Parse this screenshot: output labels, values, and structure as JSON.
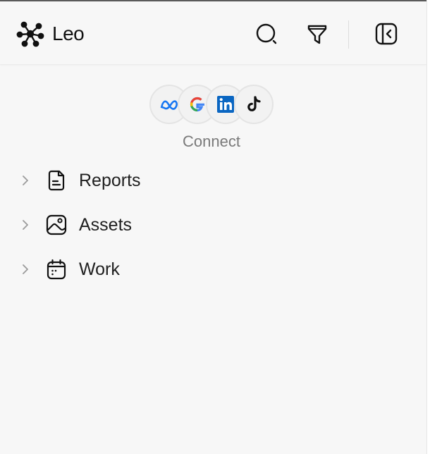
{
  "app": {
    "name": "Leo"
  },
  "header": {
    "icons": [
      "leo-logo",
      "search-icon",
      "filter-icon",
      "collapse-sidebar-icon"
    ]
  },
  "connect": {
    "label": "Connect",
    "providers": [
      "meta",
      "google",
      "linkedin",
      "tiktok"
    ]
  },
  "nav": {
    "items": [
      {
        "label": "Reports",
        "icon": "report-icon"
      },
      {
        "label": "Assets",
        "icon": "image-icon"
      },
      {
        "label": "Work",
        "icon": "calendar-icon"
      }
    ]
  },
  "colors": {
    "panel": "#f7f7f7",
    "text": "#1f1f1f",
    "muted": "#7a7a7a"
  }
}
